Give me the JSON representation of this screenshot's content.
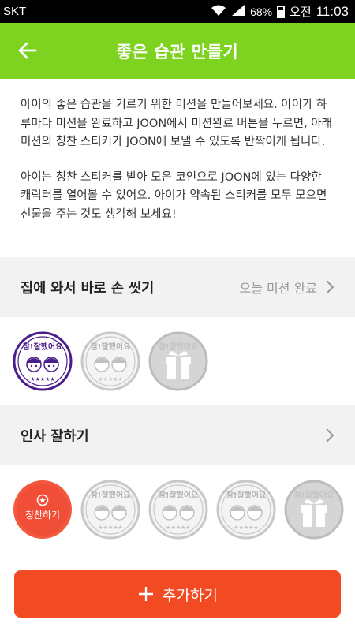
{
  "status_bar": {
    "carrier": "SKT",
    "battery": "68%",
    "ampm": "오전",
    "time": "11:03"
  },
  "header": {
    "title": "좋은 습관 만들기"
  },
  "intro": {
    "paragraph1": "아이의 좋은 습관을 기르기 위한 미션을 만들어보세요. 아이가 하루마다 미션을 완료하고 JOON에서 미션완료 버튼을 누르면, 아래 미션의 칭찬 스티커가 JOON에 보낼 수 있도록 반짝이게 됩니다.",
    "paragraph2": "아이는 칭찬 스티커를 받아 모은 코인으로 JOON에 있는 다양한 캐릭터를 열어볼 수 있어요. 아이가 약속된 스티커를 모두 모으면 선물을 주는 것도 생각해 보세요!"
  },
  "missions": [
    {
      "name": "집에 와서 바로 손 씻기",
      "status": "오늘 미션 완료",
      "stickers": [
        {
          "type": "earned",
          "text": "참!잘했어요"
        },
        {
          "type": "empty",
          "text": "참!잘했어요"
        },
        {
          "type": "gift",
          "text": "참!잘했어요"
        }
      ]
    },
    {
      "name": "인사 잘하기",
      "status": "",
      "praise_button": "칭찬하기",
      "stickers": [
        {
          "type": "praise",
          "text": "칭찬하기"
        },
        {
          "type": "empty",
          "text": "참!잘했어요"
        },
        {
          "type": "empty",
          "text": "참!잘했어요"
        },
        {
          "type": "empty",
          "text": "참!잘했어요"
        },
        {
          "type": "gift",
          "text": "참!잘했어요"
        }
      ]
    }
  ],
  "add_button": {
    "icon": "plus-icon",
    "label": "추가하기"
  },
  "colors": {
    "appbar": "#7ed321",
    "accent": "#f24a22",
    "earned_stamp": "#4a1d8c",
    "empty_stamp": "#bdbdbd"
  }
}
